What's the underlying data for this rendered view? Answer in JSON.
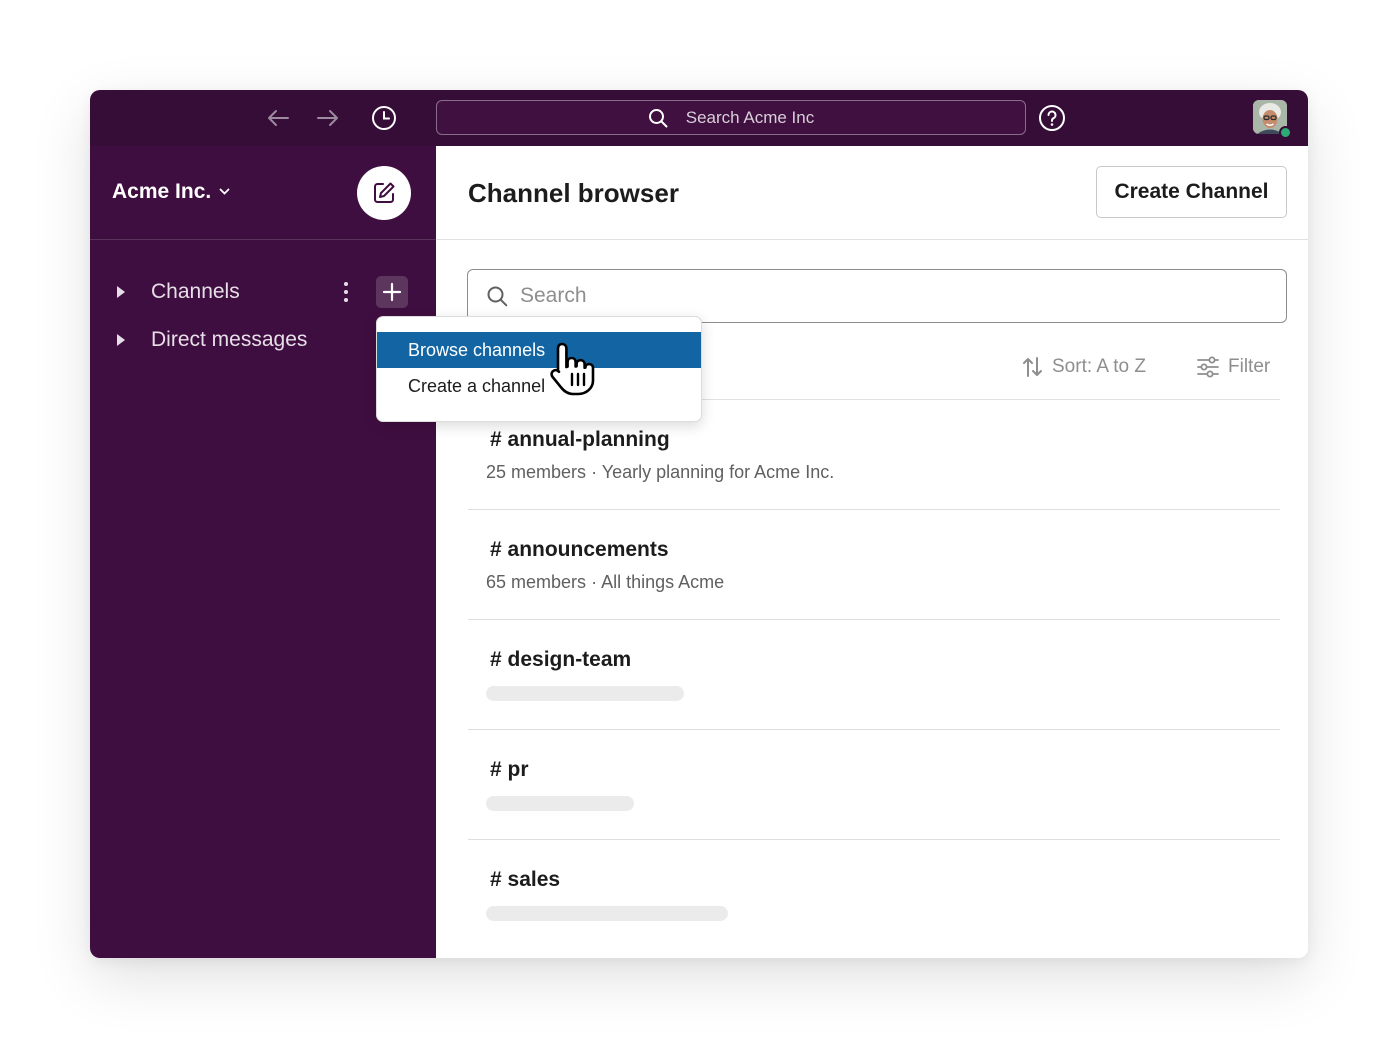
{
  "topbar": {
    "search_placeholder": "Search Acme Inc",
    "icons": [
      "back-arrow-icon",
      "forward-arrow-icon",
      "history-clock-icon",
      "search-icon",
      "help-icon"
    ],
    "presence_color": "#2bac76"
  },
  "sidebar": {
    "workspace_name": "Acme Inc.",
    "sections": [
      {
        "label": "Channels"
      },
      {
        "label": "Direct messages"
      }
    ],
    "background": "#3f0e40"
  },
  "dropdown": {
    "items": [
      {
        "label": "Browse channels",
        "active": true
      },
      {
        "label": "Create a channel",
        "active": false
      }
    ],
    "active_color": "#1264a3"
  },
  "main": {
    "title": "Channel browser",
    "create_button": "Create Channel",
    "search_placeholder": "Search",
    "sort_label": "Sort: A to Z",
    "filter_label": "Filter",
    "channels": [
      {
        "name": "# annual-planning",
        "members": "25 members",
        "description": "· Yearly planning for Acme Inc."
      },
      {
        "name": "# announcements",
        "members": "65 members",
        "description": "· All things Acme"
      },
      {
        "name": "# design-team",
        "loading": true
      },
      {
        "name": "# pr",
        "loading": true
      },
      {
        "name": "# sales",
        "loading": true
      }
    ]
  }
}
